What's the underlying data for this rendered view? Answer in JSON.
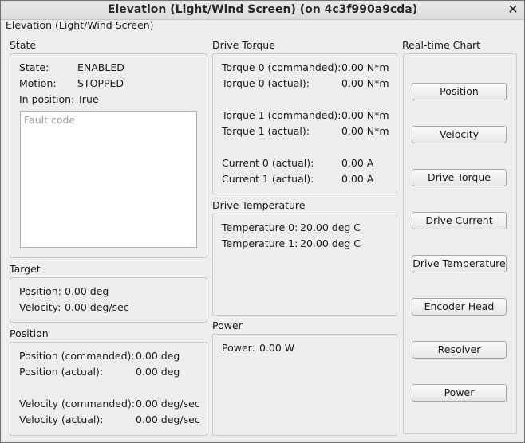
{
  "window": {
    "title": "Elevation (Light/Wind Screen) (on 4c3f990a9cda)",
    "subtitle": "Elevation (Light/Wind Screen)",
    "close_icon": "close-icon"
  },
  "state": {
    "title": "State",
    "rows": [
      {
        "label": "State:",
        "value": "ENABLED"
      },
      {
        "label": "Motion:",
        "value": "STOPPED"
      },
      {
        "label": "In position:",
        "value": "True"
      }
    ],
    "fault_placeholder": "Fault code"
  },
  "target": {
    "title": "Target",
    "rows": [
      {
        "label": "Position:",
        "value": "0.00 deg"
      },
      {
        "label": "Velocity:",
        "value": "0.00 deg/sec"
      }
    ]
  },
  "position": {
    "title": "Position",
    "rows": [
      {
        "label": "Position (commanded):",
        "value": "0.00 deg"
      },
      {
        "label": "Position (actual):",
        "value": "0.00 deg"
      },
      {
        "label": "Velocity (commanded):",
        "value": "0.00 deg/sec"
      },
      {
        "label": "Velocity (actual):",
        "value": "0.00 deg/sec"
      }
    ]
  },
  "drive_torque": {
    "title": "Drive Torque",
    "rows": [
      {
        "label": "Torque 0 (commanded):",
        "value": "0.00 N*m"
      },
      {
        "label": "Torque 0 (actual):",
        "value": "0.00 N*m"
      },
      {
        "label": "Torque 1 (commanded):",
        "value": "0.00 N*m"
      },
      {
        "label": "Torque 1 (actual):",
        "value": "0.00 N*m"
      },
      {
        "label": "Current 0 (actual):",
        "value": "0.00 A"
      },
      {
        "label": "Current 1 (actual):",
        "value": "0.00 A"
      }
    ]
  },
  "drive_temperature": {
    "title": "Drive Temperature",
    "rows": [
      {
        "label": "Temperature 0:",
        "value": "20.00 deg C"
      },
      {
        "label": "Temperature 1:",
        "value": "20.00 deg C"
      }
    ]
  },
  "power": {
    "title": "Power",
    "rows": [
      {
        "label": "Power:",
        "value": "0.00 W"
      }
    ]
  },
  "realtime_chart": {
    "title": "Real-time Chart",
    "buttons": [
      "Position",
      "Velocity",
      "Drive Torque",
      "Drive Current",
      "Drive Temperature",
      "Encoder Head",
      "Resolver",
      "Power"
    ]
  }
}
